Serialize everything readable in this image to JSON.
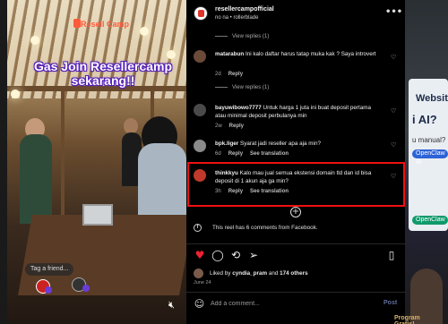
{
  "video": {
    "brand_logo": "Resell Camp",
    "promo_line1": "Gas Join Resellercamp",
    "promo_line2": "sekarang!!",
    "tag_friends": "Tag a friend...",
    "mute_icon": "mute-icon"
  },
  "header": {
    "username": "resellercampofficial",
    "subtitle": "no na • rollerblade",
    "more_icon": "more-icon"
  },
  "comments": [
    {
      "type": "view_replies",
      "label": "View replies (1)"
    },
    {
      "username": "matarabun",
      "text": "Ini kalo daftar harus tatap muka kak ? Saya introvert",
      "age": "2d",
      "reply": "Reply"
    },
    {
      "type": "view_replies",
      "label": "View replies (1)"
    },
    {
      "username": "bayuwibowo7777",
      "text": "Untuk harga 1 juta ini buat deposit pertama atau minimal deposit perbulanya min",
      "age": "2w",
      "reply": "Reply"
    },
    {
      "username": "bpk.liger",
      "text": "Syarat jadi reseller apa aja min?",
      "age": "6d",
      "reply": "Reply",
      "translation": "See translation"
    },
    {
      "username": "thinkkyu",
      "text": "Kalo mau jual semua ekstensi domain tld dan id bisa deposit di 1 akun aja ga min?",
      "age": "3h",
      "reply": "Reply",
      "translation": "See translation"
    }
  ],
  "facebook_note": "This reel has 6 comments from Facebook.",
  "likes": {
    "prefix": "Liked by",
    "user": "cyndia_pram",
    "connector": "and",
    "others": "174 others"
  },
  "date": "June 24",
  "composer": {
    "placeholder": "Add a comment...",
    "post_label": "Post",
    "bottom_peek": "Program Gratis!"
  },
  "right_backdrop": {
    "line1": "Websit",
    "line2": "i AI?",
    "line3": "u manual?",
    "chip1": "OpenClaw AI",
    "chip2": "OpenClaw"
  },
  "colors": {
    "highlight_border": "#ee1111",
    "like_heart": "#ee2233",
    "post_button": "#5f6f9c"
  }
}
